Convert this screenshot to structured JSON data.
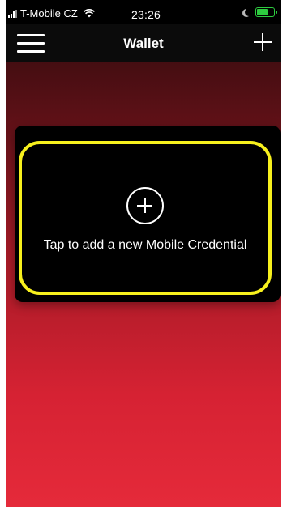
{
  "status_bar": {
    "carrier": "T-Mobile CZ",
    "time": "23:26",
    "icons": [
      "signal-icon",
      "wifi-icon",
      "moon-icon",
      "battery-charging-icon"
    ]
  },
  "nav_bar": {
    "title": "Wallet",
    "menu_icon": "hamburger-menu-icon",
    "add_icon": "plus-icon"
  },
  "card": {
    "icon": "plus-circle-icon",
    "label": "Tap to add a new Mobile Credential",
    "highlight_color": "#f7f01d"
  },
  "colors": {
    "background_top": "#2a0a0c",
    "background_bottom": "#e52a3a",
    "battery": "#2ecc40"
  }
}
